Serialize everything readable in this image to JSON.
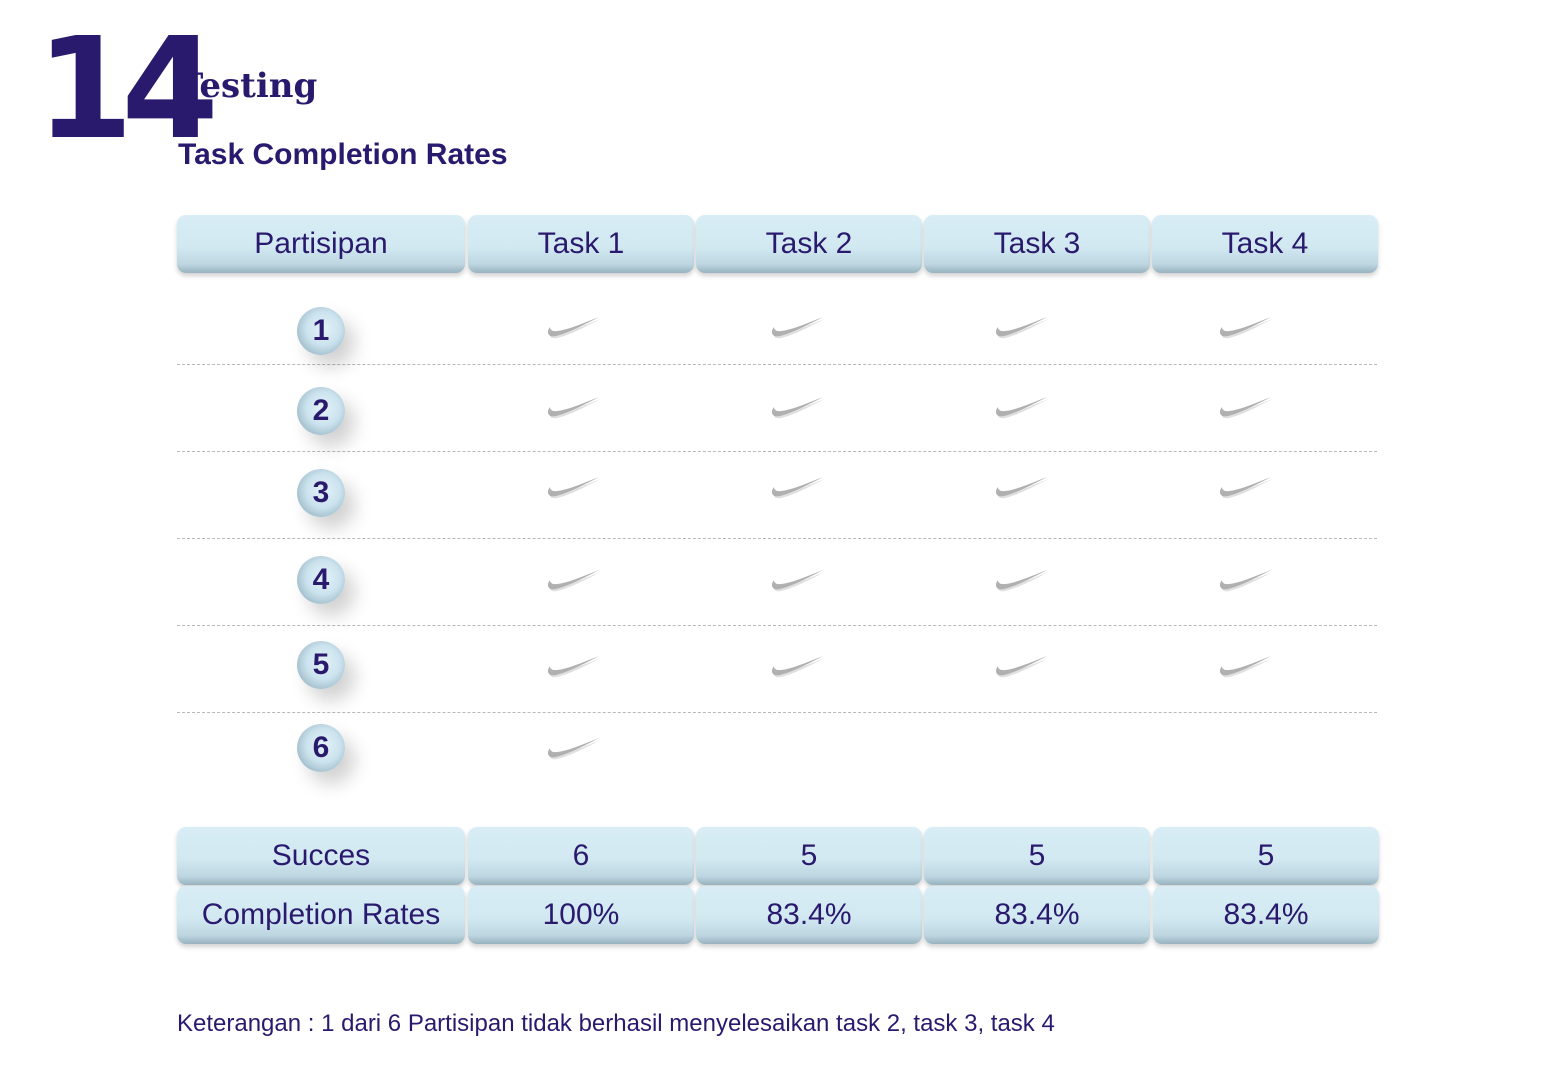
{
  "page": {
    "number": "14",
    "section": "Testing",
    "subtitle": "Task Completion Rates"
  },
  "table": {
    "headers": [
      "Partisipan",
      "Task 1",
      "Task 2",
      "Task 3",
      "Task 4"
    ],
    "participants": [
      "1",
      "2",
      "3",
      "4",
      "5",
      "6"
    ],
    "completed": [
      [
        true,
        true,
        true,
        true
      ],
      [
        true,
        true,
        true,
        true
      ],
      [
        true,
        true,
        true,
        true
      ],
      [
        true,
        true,
        true,
        true
      ],
      [
        true,
        true,
        true,
        true
      ],
      [
        true,
        false,
        false,
        false
      ]
    ],
    "success_label": "Succes",
    "success_values": [
      "6",
      "5",
      "5",
      "5"
    ],
    "rate_label": "Completion Rates",
    "rate_values": [
      "100%",
      "83.4%",
      "83.4%",
      "83.4%"
    ]
  },
  "note": "Keterangan : 1 dari 6 Partisipan tidak berhasil menyelesaikan task 2, task 3, task 4",
  "colors": {
    "text": "#2a1a6e",
    "cell": "#d2e9f2",
    "check": "#b0b0b0"
  },
  "icons": {
    "check": "check-swoosh-icon"
  }
}
